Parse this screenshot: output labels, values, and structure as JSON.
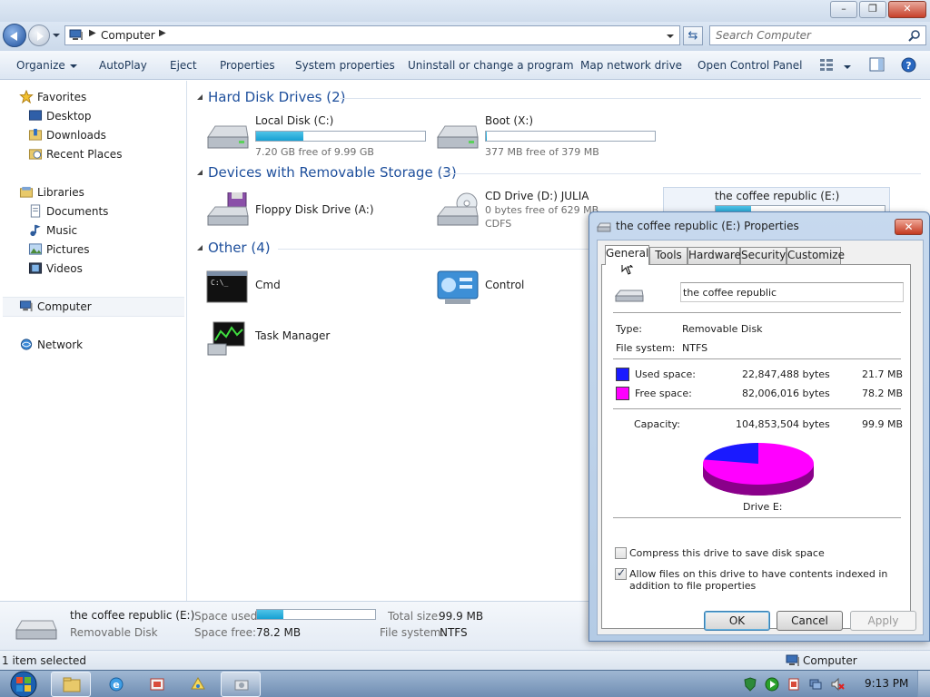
{
  "window": {
    "caption_buttons": [
      "minimize-icon",
      "restore-icon",
      "close-icon"
    ]
  },
  "address": {
    "crumb": "Computer",
    "search_placeholder": "Search Computer"
  },
  "toolbar": {
    "organize": "Organize",
    "autoplay": "AutoPlay",
    "eject": "Eject",
    "properties": "Properties",
    "system_properties": "System properties",
    "uninstall": "Uninstall or change a program",
    "map_drive": "Map network drive",
    "open_control_panel": "Open Control Panel"
  },
  "nav": {
    "favorites": "Favorites",
    "desktop": "Desktop",
    "downloads": "Downloads",
    "recent_places": "Recent Places",
    "libraries": "Libraries",
    "documents": "Documents",
    "music": "Music",
    "pictures": "Pictures",
    "videos": "Videos",
    "computer": "Computer",
    "network": "Network"
  },
  "groups": {
    "hdd": "Hard Disk Drives (2)",
    "removable": "Devices with Removable Storage (3)",
    "other": "Other (4)"
  },
  "drives": {
    "c": {
      "name": "Local Disk (C:)",
      "free": "7.20 GB free of 9.99 GB",
      "used_fraction": 0.28
    },
    "x": {
      "name": "Boot (X:)",
      "free": "377 MB free of 379 MB",
      "used_fraction": 0.005
    },
    "a": {
      "name": "Floppy Disk Drive (A:)"
    },
    "d": {
      "name": "CD Drive (D:) JULIA",
      "free": "0 bytes free of 629 MB",
      "fs": "CDFS"
    },
    "e": {
      "name": "the coffee republic (E:)",
      "used_fraction": 0.21
    }
  },
  "other": {
    "cmd": "Cmd",
    "control": "Control",
    "task_manager": "Task Manager"
  },
  "details": {
    "name": "the coffee republic (E:)",
    "type": "Removable Disk",
    "space_used_label": "Space used:",
    "space_free_label": "Space free:",
    "space_free": "78.2 MB",
    "total_label": "Total size:",
    "total": "99.9 MB",
    "fs_label": "File system:",
    "fs": "NTFS",
    "used_fraction": 0.22
  },
  "status": {
    "selected": "1 item selected",
    "location": "Computer"
  },
  "dialog": {
    "title": "the coffee republic (E:) Properties",
    "tabs": [
      "General",
      "Tools",
      "Hardware",
      "Security",
      "Customize"
    ],
    "label": "the coffee republic",
    "type_label": "Type:",
    "type": "Removable Disk",
    "fs_label": "File system:",
    "fs": "NTFS",
    "used_label": "Used space:",
    "used_bytes": "22,847,488 bytes",
    "used_mb": "21.7 MB",
    "free_label": "Free space:",
    "free_bytes": "82,006,016 bytes",
    "free_mb": "78.2 MB",
    "capacity_label": "Capacity:",
    "capacity_bytes": "104,853,504 bytes",
    "capacity_mb": "99.9 MB",
    "drive_label": "Drive E:",
    "used_color": "#1a1aff",
    "free_color": "#ff00ff",
    "compress": "Compress this drive to save disk space",
    "compress_checked": false,
    "index": "Allow files on this drive to have contents indexed in addition to file properties",
    "index_checked": true,
    "ok": "OK",
    "cancel": "Cancel",
    "apply": "Apply"
  },
  "taskbar": {
    "clock": "9:13 PM"
  }
}
